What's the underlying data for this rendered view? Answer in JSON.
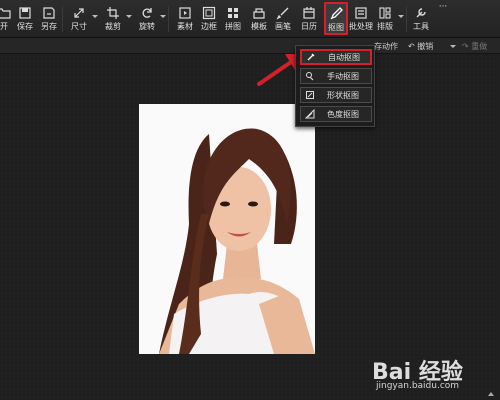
{
  "toolbar": {
    "items": [
      {
        "label": "开",
        "icon": "folder-open-icon"
      },
      {
        "label": "保存",
        "icon": "save-icon"
      },
      {
        "label": "另存",
        "icon": "save-as-icon"
      },
      {
        "label": "尺寸",
        "icon": "resize-icon"
      },
      {
        "label": "裁剪",
        "icon": "crop-icon"
      },
      {
        "label": "旋转",
        "icon": "rotate-icon"
      },
      {
        "label": "素材",
        "icon": "material-icon"
      },
      {
        "label": "边框",
        "icon": "border-icon"
      },
      {
        "label": "拼图",
        "icon": "collage-icon"
      },
      {
        "label": "模板",
        "icon": "template-icon"
      },
      {
        "label": "画笔",
        "icon": "brush-icon"
      },
      {
        "label": "日历",
        "icon": "calendar-icon"
      },
      {
        "label": "抠图",
        "icon": "cutout-pen-icon",
        "active": true
      },
      {
        "label": "批处理",
        "icon": "batch-icon"
      },
      {
        "label": "排版",
        "icon": "layout-icon"
      },
      {
        "label": "工具",
        "icon": "wrench-icon"
      },
      {
        "label": "···",
        "icon": "more-icon"
      }
    ]
  },
  "subbar": {
    "action_text": "存动作",
    "undo_label": "撤销",
    "redo_label": "重做"
  },
  "cutout_menu": {
    "items": [
      {
        "label": "自动抠图",
        "icon": "auto-cutout-icon",
        "selected": true
      },
      {
        "label": "手动抠图",
        "icon": "manual-cutout-icon"
      },
      {
        "label": "形状抠图",
        "icon": "shape-cutout-icon"
      },
      {
        "label": "色度抠图",
        "icon": "chroma-cutout-icon"
      }
    ]
  },
  "watermark": {
    "logo_text": "Bai 经验",
    "url": "jingyan.baidu.com"
  },
  "colors": {
    "highlight": "#d4202a",
    "background": "#1e1e1e",
    "toolbar": "#2a2a2a"
  }
}
